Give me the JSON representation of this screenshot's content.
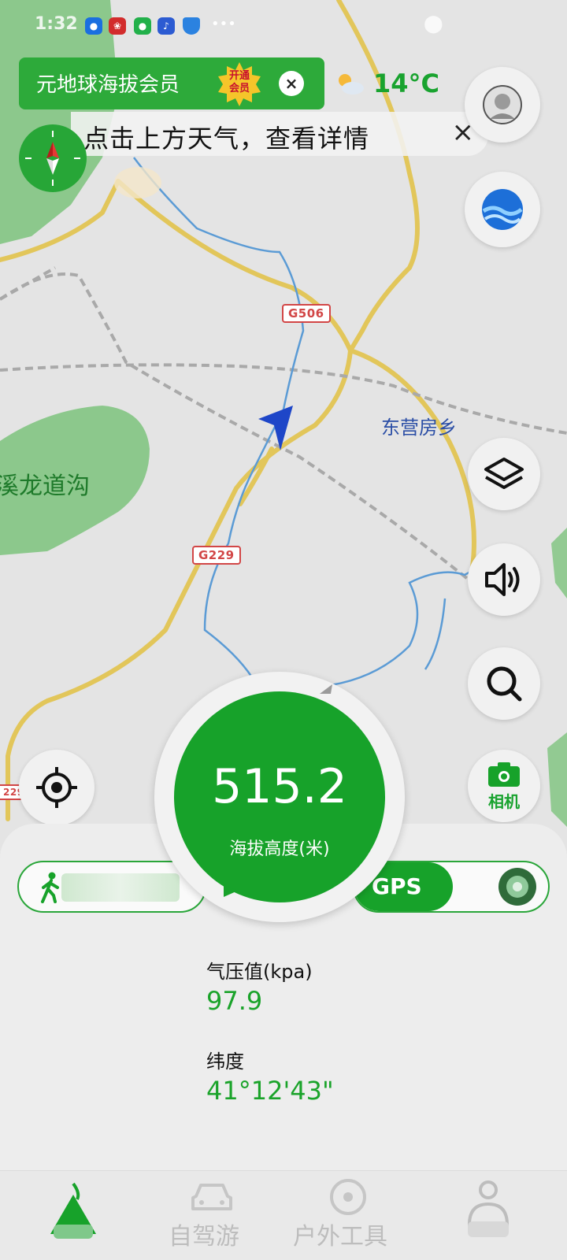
{
  "status_bar": {
    "time": "1:32"
  },
  "member_banner": {
    "text": "元地球海拔会员",
    "badge": "开通会员",
    "close": "×"
  },
  "weather": {
    "temperature": "14°C",
    "icon": "partly-cloudy-icon"
  },
  "tip": {
    "text": "点击上方天气，查看详情",
    "close": "×"
  },
  "map": {
    "roads": [
      "G506",
      "G229",
      "229"
    ],
    "places": [
      "东营房乡",
      "溪龙道沟"
    ]
  },
  "camera": {
    "label": "相机"
  },
  "altitude": {
    "value": "515.2",
    "label": "海拔高度(米)"
  },
  "gps": {
    "label": "GPS"
  },
  "stats": [
    {
      "label": "气压值(kpa)",
      "value": "97.9"
    },
    {
      "label": "纬度",
      "value": "41°12'43\""
    }
  ],
  "nav": {
    "items": [
      "自驾游",
      "户外工具"
    ]
  },
  "colors": {
    "accent": "#17a22a",
    "road_badge": "#d24646",
    "water": "#5b9bd5"
  }
}
